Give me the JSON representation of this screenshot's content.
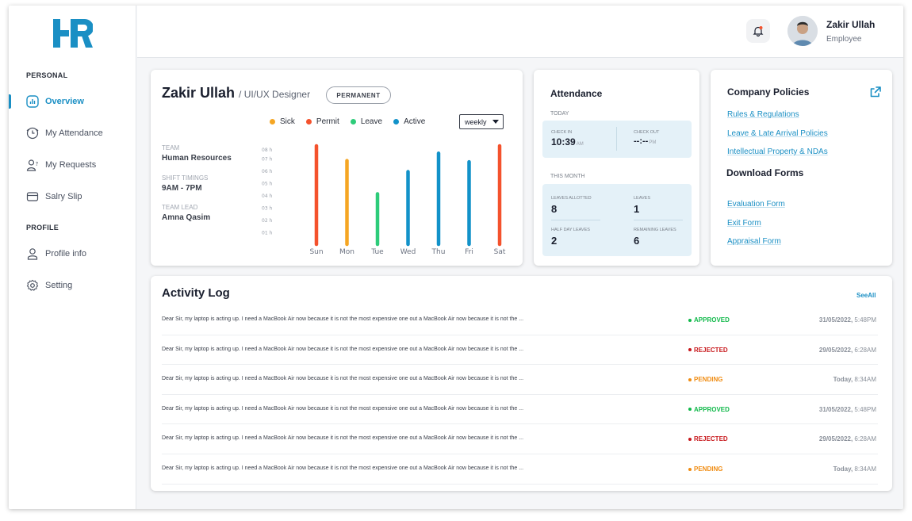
{
  "colors": {
    "accent": "#1a8fc4",
    "sick": "#f5a623",
    "permit": "#f4522d",
    "leave": "#2ecc7a",
    "active": "#1292c9",
    "approved": "#10b94a",
    "rejected": "#c8181c",
    "pending": "#f08c12"
  },
  "brand": {
    "logo_text": "HR"
  },
  "sidebar": {
    "personal_label": "PERSONAL",
    "profile_label": "PROFILE",
    "items": [
      {
        "label": "Overview",
        "icon": "chart-icon",
        "active": true
      },
      {
        "label": "My Attendance",
        "icon": "clock-icon"
      },
      {
        "label": "My Requests",
        "icon": "user-question-icon"
      },
      {
        "label": "Salry Slip",
        "icon": "wallet-icon"
      },
      {
        "label": "Profile info",
        "icon": "user-icon"
      },
      {
        "label": "Setting",
        "icon": "gear-icon"
      }
    ]
  },
  "header": {
    "user_name": "Zakir Ullah",
    "user_role": "Employee",
    "bell_icon": "bell-icon"
  },
  "profile": {
    "name": "Zakir Ullah",
    "role": "/ UI/UX Designer",
    "employment_badge": "PERMANENT",
    "team_label": "TEAM",
    "team": "Human Resources",
    "shift_label": "SHIFT TIMINGS",
    "shift": "9AM - 7PM",
    "lead_label": "TEAM LEAD",
    "lead": "Amna Qasim",
    "period": "weekly"
  },
  "chart_data": {
    "type": "bar",
    "legend": [
      "Sick",
      "Permit",
      "Leave",
      "Active"
    ],
    "y_ticks": [
      "08 h",
      "07 h",
      "06 h",
      "05 h",
      "04 h",
      "03 h",
      "02 h",
      "01 h"
    ],
    "ylim": [
      0,
      8
    ],
    "categories": [
      "Sun",
      "Mon",
      "Tue",
      "Wed",
      "Thu",
      "Fri",
      "Sat"
    ],
    "values": [
      8,
      6.8,
      4.1,
      5.9,
      7.4,
      6.7,
      8
    ],
    "bar_series": [
      "Permit",
      "Sick",
      "Leave",
      "Active",
      "Active",
      "Active",
      "Permit"
    ],
    "grid": false
  },
  "attendance": {
    "title": "Attendance",
    "today_label": "TODAY",
    "check_in_label": "CHECK IN",
    "check_in": "10:39",
    "check_in_ampm": "AM",
    "check_out_label": "CHECK OUT",
    "check_out": "--:--",
    "check_out_ampm": "PM",
    "month_label": "THIS MONTH",
    "leaves_allotted_label": "LEAVES ALLOTTED",
    "leaves_allotted": "8",
    "leaves_label": "LEAVES",
    "leaves": "1",
    "half_day_label": "HALF DAY LEAVES",
    "half_day": "2",
    "remaining_label": "REMAINING LEAVES",
    "remaining": "6"
  },
  "policies": {
    "title": "Company Policies",
    "links": [
      "Rules & Regulations",
      "Leave & Late Arrival Policies",
      "Intellectual Property & NDAs"
    ],
    "forms_title": "Download Forms",
    "forms": [
      "Evaluation Form",
      "Exit Form",
      "Appraisal Form"
    ]
  },
  "activity": {
    "title": "Activity Log",
    "see_all": "SeeAll",
    "rows": [
      {
        "message": "Dear Sir, my laptop is acting up. I need a MacBook Air now because it is not the most expensive one out  a MacBook Air now because it is not the ...",
        "status": "APPROVED",
        "date": "31/05/2022,",
        "time": "5:48PM"
      },
      {
        "message": "Dear Sir, my laptop is acting up. I need a MacBook Air now because it is not the most expensive one out  a MacBook Air now because it is not the ...",
        "status": "REJECTED",
        "date": "29/05/2022,",
        "time": "6:28AM"
      },
      {
        "message": "Dear Sir, my laptop is acting up. I need a MacBook Air now because it is not the most expensive one out  a MacBook Air now because it is not the ...",
        "status": "PENDING",
        "date": "Today,",
        "time": "8:34AM"
      },
      {
        "message": "Dear Sir, my laptop is acting up. I need a MacBook Air now because it is not the most expensive one out  a MacBook Air now because it is not the ...",
        "status": "APPROVED",
        "date": "31/05/2022,",
        "time": "5:48PM"
      },
      {
        "message": "Dear Sir, my laptop is acting up. I need a MacBook Air now because it is not the most expensive one out  a MacBook Air now because it is not the ...",
        "status": "REJECTED",
        "date": "29/05/2022,",
        "time": "6:28AM"
      },
      {
        "message": "Dear Sir, my laptop is acting up. I need a MacBook Air now because it is not the most expensive one out  a MacBook Air now because it is not the ...",
        "status": "PENDING",
        "date": "Today,",
        "time": "8:34AM"
      }
    ]
  }
}
